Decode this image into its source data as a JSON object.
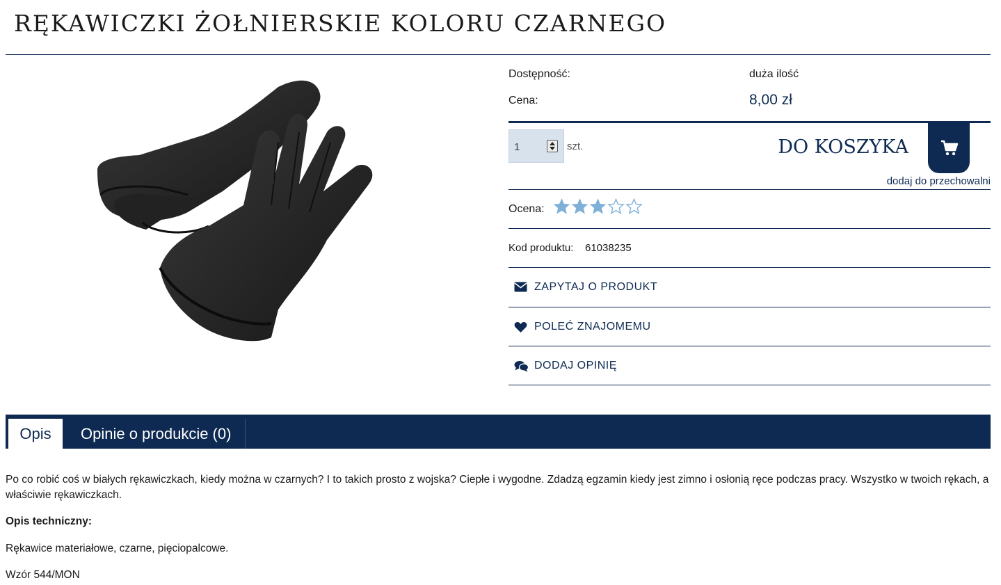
{
  "product": {
    "title": "RĘKAWICZKI ŻOŁNIERSKIE KOLORU CZARNEGO",
    "image_alt": "black-gloves-photo"
  },
  "info": {
    "availability_label": "Dostępność:",
    "availability_value": "duża ilość",
    "price_label": "Cena:",
    "price_value": "8,00 zł",
    "quantity_value": "1",
    "quantity_unit": "szt.",
    "add_to_cart_label": "DO KOSZYKA",
    "cart_icon": "shopping-cart-icon",
    "store_link": "dodaj do przechowalni",
    "rating_label": "Ocena:",
    "rating_value": 3,
    "rating_max": 5,
    "code_label": "Kod produktu:",
    "code_value": "61038235"
  },
  "actions": [
    {
      "label": "ZAPYTAJ O PRODUKT",
      "icon": "envelope-icon"
    },
    {
      "label": "POLEĆ ZNAJOMEMU",
      "icon": "heart-icon"
    },
    {
      "label": "DODAJ OPINIĘ",
      "icon": "comments-icon"
    }
  ],
  "tabs": [
    {
      "label": "Opis",
      "active": true
    },
    {
      "label": "Opinie o produkcie (0)",
      "active": false
    }
  ],
  "description": {
    "intro": "Po co robić coś w białych rękawiczkach, kiedy można w czarnych? I to takich prosto z wojska? Ciepłe i wygodne. Zdadzą egzamin kiedy jest zimno i osłonią ręce podczas pracy. Wszystko w twoich rękach, a właściwie rękawiczkach.",
    "tech_heading": "Opis techniczny:",
    "tech_text": "Rękawice materiałowe, czarne, pięciopalcowe.",
    "pattern": "Wzór 544/MON"
  },
  "colors": {
    "brand_navy": "#0e2a52",
    "star_fill": "#7fb0d8"
  }
}
